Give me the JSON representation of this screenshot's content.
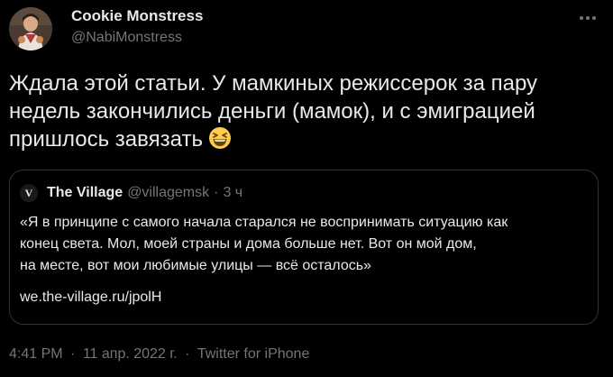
{
  "author": {
    "display_name": "Cookie Monstress",
    "handle": "@NabiMonstress"
  },
  "tweet": {
    "text": "Ждала этой статьи. У мамкиных режиссерок за пару недель закончились деньги (мамок), и с эмиграцией пришлось завязать",
    "emoji": "grinning-squinting-face-emoji"
  },
  "quoted": {
    "logo_letter": "V",
    "name": "The Village",
    "handle": "@villagemsk",
    "separator": "·",
    "time": "3 ч",
    "lines": [
      "«Я в принципе с самого начала старался не воспринимать ситуацию как",
      "конец света. Мол, моей страны и дома больше нет. Вот он мой дом,",
      "на месте, вот мои любимые улицы — всё осталось»"
    ],
    "link": "we.the-village.ru/jpolH"
  },
  "meta": {
    "time": "4:41 PM",
    "sep1": "·",
    "date": "11 апр. 2022 г.",
    "sep2": "·",
    "source": "Twitter for iPhone"
  },
  "colors": {
    "background": "#000000",
    "text": "#e7e9ea",
    "secondary": "#71767b",
    "border": "#2f3336",
    "emoji": "#ffcc4d"
  }
}
